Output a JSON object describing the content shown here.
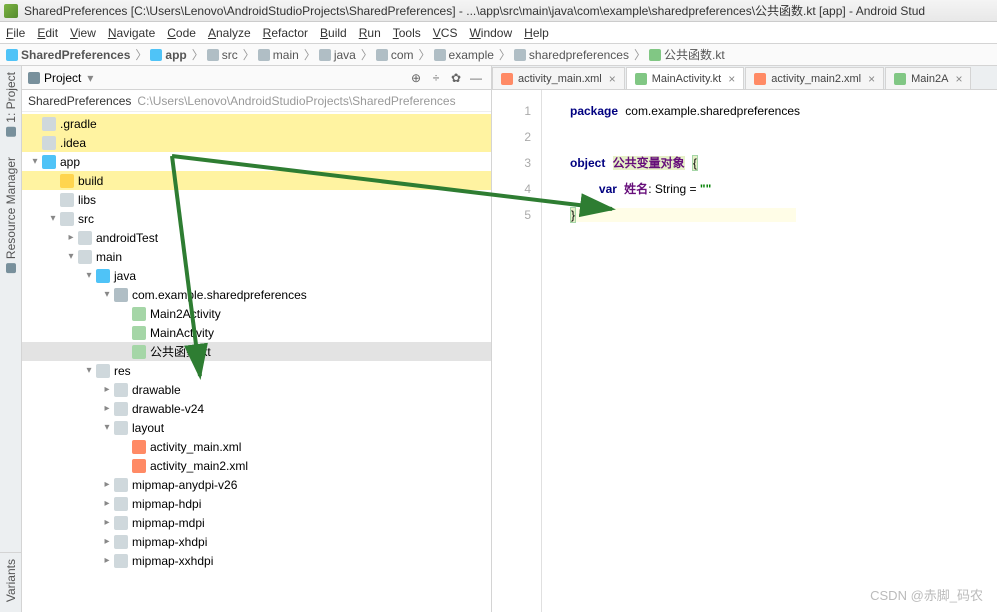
{
  "title": "SharedPreferences [C:\\Users\\Lenovo\\AndroidStudioProjects\\SharedPreferences] - ...\\app\\src\\main\\java\\com\\example\\sharedpreferences\\公共函数.kt [app] - Android Stud",
  "menu": [
    "File",
    "Edit",
    "View",
    "Navigate",
    "Code",
    "Analyze",
    "Refactor",
    "Build",
    "Run",
    "Tools",
    "VCS",
    "Window",
    "Help"
  ],
  "breadcrumb": [
    {
      "label": "SharedPreferences",
      "cls": "ico-mod",
      "bold": true
    },
    {
      "label": "app",
      "cls": "ico-mod",
      "bold": true
    },
    {
      "label": "src",
      "cls": "ico-fld"
    },
    {
      "label": "main",
      "cls": "ico-fld"
    },
    {
      "label": "java",
      "cls": "ico-fld"
    },
    {
      "label": "com",
      "cls": "ico-pkg"
    },
    {
      "label": "example",
      "cls": "ico-pkg"
    },
    {
      "label": "sharedpreferences",
      "cls": "ico-pkg"
    },
    {
      "label": "公共函数.kt",
      "cls": "ico-kt"
    }
  ],
  "leftStrip": [
    "1: Project",
    "Resource Manager",
    "Variants"
  ],
  "projectPanel": {
    "title": "Project",
    "path": {
      "name": "SharedPreferences",
      "loc": "C:\\Users\\Lenovo\\AndroidStudioProjects\\SharedPreferences"
    },
    "tree": [
      {
        "d": 0,
        "a": "",
        "ic": "ic-folder",
        "t": ".gradle",
        "hl": true
      },
      {
        "d": 0,
        "a": "",
        "ic": "ic-folder",
        "t": ".idea",
        "hl": true
      },
      {
        "d": 0,
        "a": "▾",
        "ic": "ic-mod",
        "t": "app"
      },
      {
        "d": 1,
        "a": "",
        "ic": "ic-folder-y",
        "t": "build",
        "hl": true
      },
      {
        "d": 1,
        "a": "",
        "ic": "ic-folder",
        "t": "libs"
      },
      {
        "d": 1,
        "a": "▾",
        "ic": "ic-folder",
        "t": "src"
      },
      {
        "d": 2,
        "a": "▸",
        "ic": "ic-folder",
        "t": "androidTest"
      },
      {
        "d": 2,
        "a": "▾",
        "ic": "ic-folder",
        "t": "main"
      },
      {
        "d": 3,
        "a": "▾",
        "ic": "ic-folder-b",
        "t": "java"
      },
      {
        "d": 4,
        "a": "▾",
        "ic": "ic-pkg",
        "t": "com.example.sharedpreferences"
      },
      {
        "d": 5,
        "a": "",
        "ic": "ic-kt",
        "t": "Main2Activity"
      },
      {
        "d": 5,
        "a": "",
        "ic": "ic-kt",
        "t": "MainActivity"
      },
      {
        "d": 5,
        "a": "",
        "ic": "ic-kt",
        "t": "公共函数.kt",
        "sel": true
      },
      {
        "d": 3,
        "a": "▾",
        "ic": "ic-folder",
        "t": "res"
      },
      {
        "d": 4,
        "a": "▸",
        "ic": "ic-folder",
        "t": "drawable"
      },
      {
        "d": 4,
        "a": "▸",
        "ic": "ic-folder",
        "t": "drawable-v24"
      },
      {
        "d": 4,
        "a": "▾",
        "ic": "ic-folder",
        "t": "layout"
      },
      {
        "d": 5,
        "a": "",
        "ic": "ic-xml",
        "t": "activity_main.xml"
      },
      {
        "d": 5,
        "a": "",
        "ic": "ic-xml",
        "t": "activity_main2.xml"
      },
      {
        "d": 4,
        "a": "▸",
        "ic": "ic-folder",
        "t": "mipmap-anydpi-v26"
      },
      {
        "d": 4,
        "a": "▸",
        "ic": "ic-folder",
        "t": "mipmap-hdpi"
      },
      {
        "d": 4,
        "a": "▸",
        "ic": "ic-folder",
        "t": "mipmap-mdpi"
      },
      {
        "d": 4,
        "a": "▸",
        "ic": "ic-folder",
        "t": "mipmap-xhdpi"
      },
      {
        "d": 4,
        "a": "▸",
        "ic": "ic-folder",
        "t": "mipmap-xxhdpi"
      }
    ]
  },
  "editor": {
    "tabs": [
      {
        "label": "activity_main.xml",
        "ic": "#ff8a65"
      },
      {
        "label": "MainActivity.kt",
        "ic": "#81c784",
        "active": true
      },
      {
        "label": "activity_main2.xml",
        "ic": "#ff8a65"
      },
      {
        "label": "Main2A",
        "ic": "#81c784"
      }
    ],
    "lines": [
      "1",
      "2",
      "3",
      "4",
      "5"
    ],
    "code": {
      "pkg_kw": "package",
      "pkg": "com.example.sharedpreferences",
      "obj_kw": "object",
      "obj_name": "公共变量对象",
      "var_kw": "var",
      "var_name": "姓名",
      "type": ": String = ",
      "str": "\"\""
    }
  },
  "watermark": "CSDN @赤脚_码农"
}
